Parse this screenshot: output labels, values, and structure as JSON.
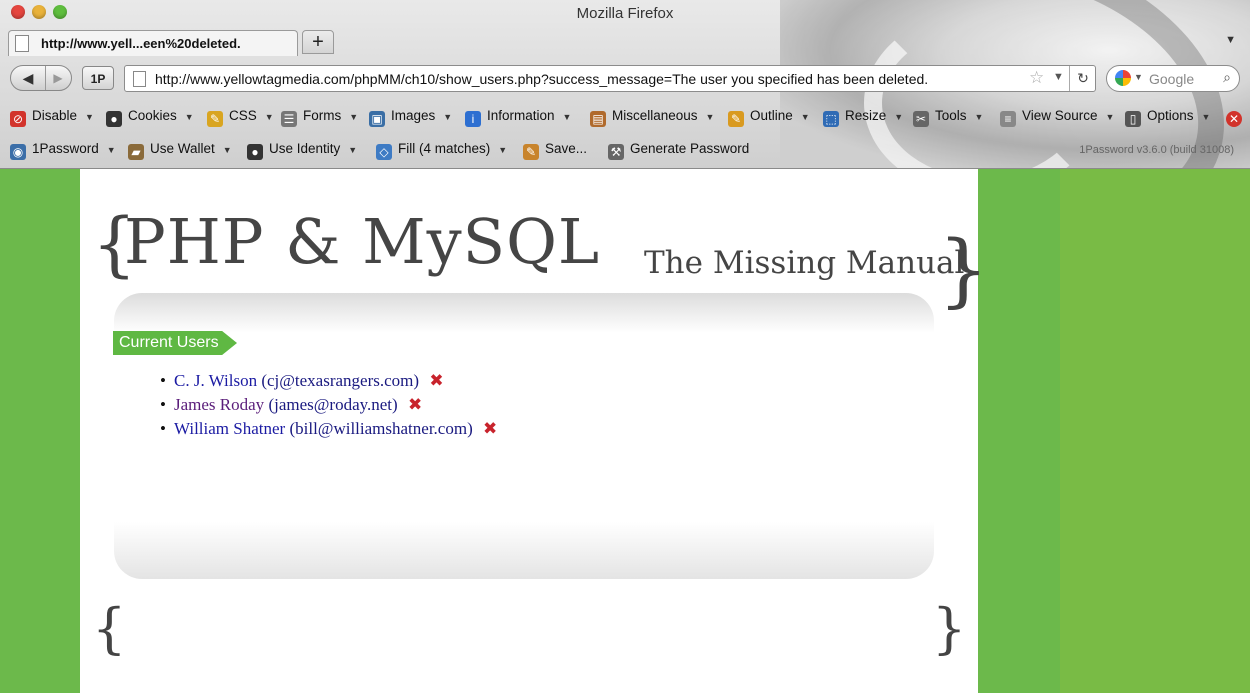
{
  "window": {
    "title": "Mozilla Firefox"
  },
  "tab": {
    "label": "http://www.yell...een%20deleted.",
    "new_tab": "+"
  },
  "nav": {
    "back": "◀",
    "forward": "▶",
    "onepassword_button": "1P",
    "url": "http://www.yellowtagmedia.com/phpMM/ch10/show_users.php?success_message=The user you specified has been deleted.",
    "search_placeholder": "Google"
  },
  "dev_toolbar": [
    {
      "label": "Disable",
      "icon": "disable-icon",
      "color": "#d2332b"
    },
    {
      "label": "Cookies",
      "icon": "cookie-user-icon",
      "color": "#333333"
    },
    {
      "label": "CSS",
      "icon": "css-pencil-icon",
      "color": "#d9a520"
    },
    {
      "label": "Forms",
      "icon": "forms-icon",
      "color": "#777777"
    },
    {
      "label": "Images",
      "icon": "images-icon",
      "color": "#3a6ea5"
    },
    {
      "label": "Information",
      "icon": "info-icon",
      "color": "#2d6fd1"
    },
    {
      "label": "Miscellaneous",
      "icon": "misc-icon",
      "color": "#b06a2c"
    },
    {
      "label": "Outline",
      "icon": "outline-pencil-icon",
      "color": "#d99a20"
    },
    {
      "label": "Resize",
      "icon": "resize-icon",
      "color": "#2f6bb5"
    },
    {
      "label": "Tools",
      "icon": "tools-icon",
      "color": "#666666"
    },
    {
      "label": "View Source",
      "icon": "view-source-icon",
      "color": "#888888"
    },
    {
      "label": "Options",
      "icon": "options-icon",
      "color": "#555555"
    }
  ],
  "password_toolbar": [
    {
      "label": "1Password",
      "icon": "onepassword-icon",
      "color": "#3b6ea8"
    },
    {
      "label": "Use Wallet",
      "icon": "wallet-icon",
      "color": "#8a6a3a"
    },
    {
      "label": "Use Identity",
      "icon": "identity-icon",
      "color": "#333333"
    },
    {
      "label": "Fill (4 matches)",
      "icon": "fill-icon",
      "color": "#3e7bc4"
    },
    {
      "label": "Save...",
      "icon": "save-icon",
      "color": "#c8842c"
    },
    {
      "label": "Generate Password",
      "icon": "generate-icon",
      "color": "#666666"
    }
  ],
  "onepassword_version": "1Password v3.6.0 (build 31008)",
  "page": {
    "title": "PHP & MySQL",
    "subtitle": "The Missing Manual",
    "section_label": "Current Users",
    "users": [
      {
        "name": "C. J. Wilson",
        "email": "(cj@texasrangers.com)"
      },
      {
        "name": "James Roday",
        "email": "(james@roday.net)"
      },
      {
        "name": "William Shatner",
        "email": "(bill@williamshatner.com)"
      }
    ]
  },
  "colors": {
    "page_green": "#6cb94b",
    "tag_green": "#5fb843",
    "delete_red": "#c8232c",
    "link_blue": "#1b1ba3"
  }
}
